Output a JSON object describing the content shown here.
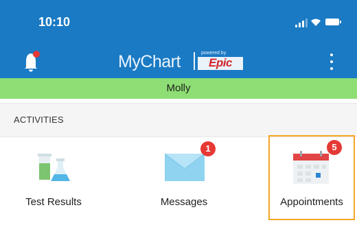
{
  "status_bar": {
    "time": "10:10",
    "icons": [
      "cellular-signal-icon",
      "wifi-icon",
      "battery-icon"
    ]
  },
  "nav_bar": {
    "logo_text": "MyChart",
    "logo_tagline": "powered by",
    "logo_brand": "Epic",
    "left_icon": "notification-bell-icon",
    "right_icon": "more-vertical-icon",
    "color": "#1a7ac4"
  },
  "patient": {
    "name": "Molly",
    "bar_color": "#8dde74"
  },
  "activities": {
    "section_title": "ACTIVITIES",
    "items": [
      {
        "label": "Test Results",
        "icon": "test-results-flasks-icon"
      },
      {
        "label": "Messages",
        "icon": "envelope-icon",
        "badge": "1"
      },
      {
        "label": "Appointments",
        "icon": "calendar-icon",
        "badge": "5",
        "highlighted": true
      }
    ]
  },
  "colors": {
    "badge": "#e53935",
    "highlight_border": "#f5a623"
  }
}
